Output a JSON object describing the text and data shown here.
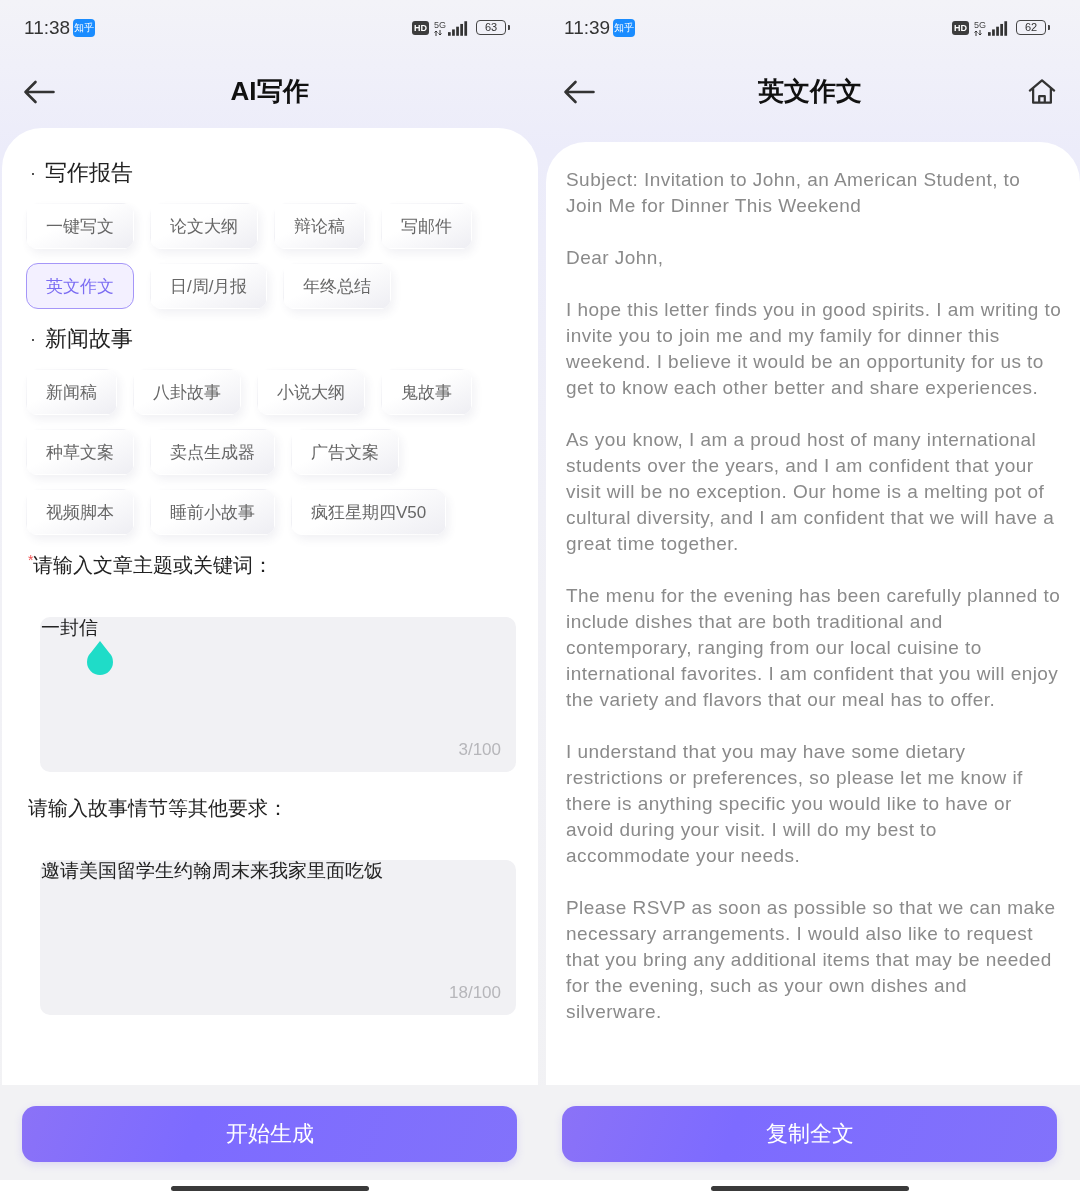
{
  "writing_screen": {
    "status_bar": {
      "time": "11:38",
      "app_badge": "知乎",
      "hd_badge": "HD",
      "network": "5G",
      "battery": "63"
    },
    "header": {
      "title": "AI写作"
    },
    "sections": [
      {
        "bullet": "·",
        "title": "写作报告",
        "chips": [
          {
            "label": "一键写文",
            "selected": false
          },
          {
            "label": "论文大纲",
            "selected": false
          },
          {
            "label": "辩论稿",
            "selected": false
          },
          {
            "label": "写邮件",
            "selected": false
          },
          {
            "label": "英文作文",
            "selected": true
          },
          {
            "label": "日/周/月报",
            "selected": false
          },
          {
            "label": "年终总结",
            "selected": false
          }
        ]
      },
      {
        "bullet": "·",
        "title": "新闻故事",
        "chips": [
          {
            "label": "新闻稿",
            "selected": false
          },
          {
            "label": "八卦故事",
            "selected": false
          },
          {
            "label": "小说大纲",
            "selected": false
          },
          {
            "label": "鬼故事",
            "selected": false
          },
          {
            "label": "种草文案",
            "selected": false
          },
          {
            "label": "卖点生成器",
            "selected": false
          },
          {
            "label": "广告文案",
            "selected": false
          },
          {
            "label": "视频脚本",
            "selected": false
          },
          {
            "label": "睡前小故事",
            "selected": false
          },
          {
            "label": "疯狂星期四V50",
            "selected": false
          }
        ]
      }
    ],
    "fields": [
      {
        "required_mark": "*",
        "label": "请输入文章主题或关键词：",
        "value": "一封信",
        "counter": "3/100",
        "focused": true
      },
      {
        "label": "请输入故事情节等其他要求：",
        "value": "邀请美国留学生约翰周末来我家里面吃饭",
        "counter": "18/100",
        "focused": false
      }
    ],
    "action_button": "开始生成"
  },
  "result_screen": {
    "status_bar": {
      "time": "11:39",
      "app_badge": "知乎",
      "hd_badge": "HD",
      "network": "5G",
      "battery": "62"
    },
    "header": {
      "title": "英文作文",
      "home_button": true
    },
    "paragraphs": [
      "Subject: Invitation to John, an American Student, to Join Me for Dinner This Weekend",
      "Dear John,",
      "I hope this letter finds you in good spirits. I am writing to invite you to join me and my family for dinner this weekend. I believe it would be an opportunity for us to get to know each other better and share experiences.",
      "As you know, I am a proud host of many international students over the years, and I am confident that your visit will be no exception. Our home is a melting pot of cultural diversity, and I am confident that we will have a great time together.",
      "The menu for the evening has been carefully planned to include dishes that are both traditional and contemporary, ranging from our local cuisine to international favorites. I am confident that you will enjoy the variety and flavors that our meal has to offer.",
      "I understand that you may have some dietary restrictions or preferences, so please let me know if there is anything specific you would like to have or avoid during your visit. I will do my best to accommodate your needs.",
      "Please RSVP as soon as possible so that we can make necessary arrangements. I would also like to request that you bring any additional items that may be needed for the evening, such as your own dishes and silverware."
    ],
    "action_button": "复制全文"
  }
}
